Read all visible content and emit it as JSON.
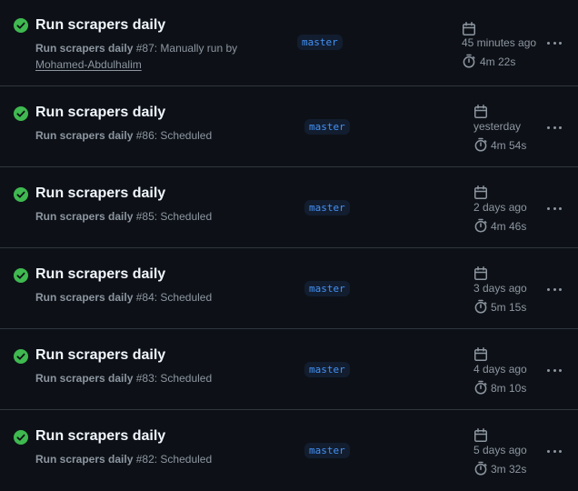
{
  "runs": [
    {
      "title": "Run scrapers daily",
      "workflow": "Run scrapers daily",
      "number": " #87",
      "event": ": Manually run by",
      "actor": "Mohamed-Abdulhalim",
      "branch": "master",
      "time_ago": "45 minutes ago",
      "duration": "4m 22s",
      "status": "success"
    },
    {
      "title": "Run scrapers daily",
      "workflow": "Run scrapers daily",
      "number": " #86",
      "event": ": Scheduled",
      "branch": "master",
      "time_ago": "yesterday",
      "duration": "4m 54s",
      "status": "success"
    },
    {
      "title": "Run scrapers daily",
      "workflow": "Run scrapers daily",
      "number": " #85",
      "event": ": Scheduled",
      "branch": "master",
      "time_ago": "2 days ago",
      "duration": "4m 46s",
      "status": "success"
    },
    {
      "title": "Run scrapers daily",
      "workflow": "Run scrapers daily",
      "number": " #84",
      "event": ": Scheduled",
      "branch": "master",
      "time_ago": "3 days ago",
      "duration": "5m 15s",
      "status": "success"
    },
    {
      "title": "Run scrapers daily",
      "workflow": "Run scrapers daily",
      "number": " #83",
      "event": ": Scheduled",
      "branch": "master",
      "time_ago": "4 days ago",
      "duration": "8m 10s",
      "status": "success"
    },
    {
      "title": "Run scrapers daily",
      "workflow": "Run scrapers daily",
      "number": " #82",
      "event": ": Scheduled",
      "branch": "master",
      "time_ago": "5 days ago",
      "duration": "3m 32s",
      "status": "success"
    }
  ],
  "colors": {
    "background": "#0d1117",
    "success": "#3fb950",
    "title": "#f0f6fc",
    "muted": "#8d96a0",
    "branch_text": "#4493f8",
    "branch_bg": "#121d2f",
    "divider": "#30363d"
  },
  "icons": {
    "status": "check-circle-fill-icon",
    "date": "calendar-icon",
    "duration": "stopwatch-icon",
    "menu": "kebab-horizontal-icon"
  }
}
